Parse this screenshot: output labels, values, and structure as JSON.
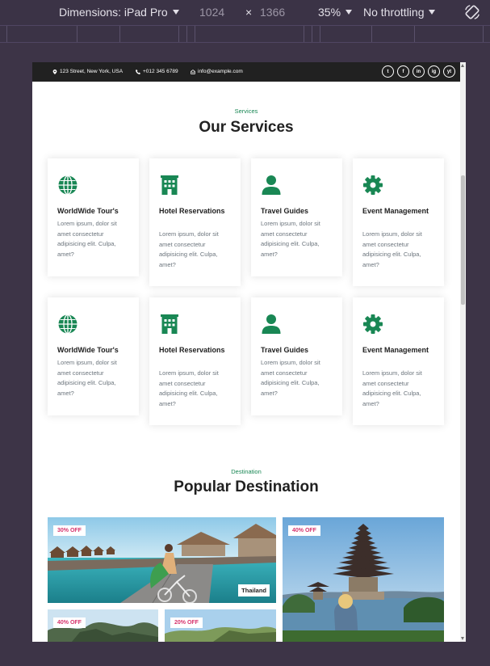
{
  "devtools": {
    "dimensions_label": "Dimensions: iPad Pro",
    "width": "1024",
    "times": "×",
    "height": "1366",
    "zoom": "35%",
    "throttling": "No throttling",
    "rotate_icon": "rotate-icon"
  },
  "topbar": {
    "address": "123 Street, New York, USA",
    "phone": "+012 345 6789",
    "email": "info@example.com",
    "socials": [
      "t",
      "f",
      "in",
      "ig",
      "yt"
    ],
    "social_names": [
      "twitter-icon",
      "facebook-icon",
      "linkedin-icon",
      "instagram-icon",
      "youtube-icon"
    ]
  },
  "services": {
    "subtitle": "Services",
    "title": "Our Services",
    "cards": [
      {
        "icon": "globe-icon",
        "title": "WorldWide Tour's",
        "desc": "Lorem ipsum, dolor sit amet consectetur adipisicing elit. Culpa, amet?"
      },
      {
        "icon": "hotel-icon",
        "title": "Hotel Reservations",
        "desc": "Lorem ipsum, dolor sit amet consectetur adipisicing elit. Culpa, amet?"
      },
      {
        "icon": "user-icon",
        "title": "Travel Guides",
        "desc": "Lorem ipsum, dolor sit amet consectetur adipisicing elit. Culpa, amet?"
      },
      {
        "icon": "gear-icon",
        "title": "Event Management",
        "desc": "Lorem ipsum, dolor sit amet consectetur adipisicing elit. Culpa, amet?"
      },
      {
        "icon": "globe-icon",
        "title": "WorldWide Tour's",
        "desc": "Lorem ipsum, dolor sit amet consectetur adipisicing elit. Culpa, amet?"
      },
      {
        "icon": "hotel-icon",
        "title": "Hotel Reservations",
        "desc": "Lorem ipsum, dolor sit amet consectetur adipisicing elit. Culpa, amet?"
      },
      {
        "icon": "user-icon",
        "title": "Travel Guides",
        "desc": "Lorem ipsum, dolor sit amet consectetur adipisicing elit. Culpa, amet?"
      },
      {
        "icon": "gear-icon",
        "title": "Event Management",
        "desc": "Lorem ipsum, dolor sit amet consectetur adipisicing elit. Culpa, amet?"
      }
    ]
  },
  "destination": {
    "subtitle": "Destination",
    "title": "Popular Destination",
    "items": [
      {
        "badge": "30% OFF",
        "label": "Thailand"
      },
      {
        "badge": "40% OFF",
        "label": ""
      },
      {
        "badge": "40% OFF",
        "label": ""
      },
      {
        "badge": "20% OFF",
        "label": ""
      }
    ]
  },
  "colors": {
    "accent": "#198754",
    "badge": "#d6336c",
    "topbar": "#212121"
  }
}
